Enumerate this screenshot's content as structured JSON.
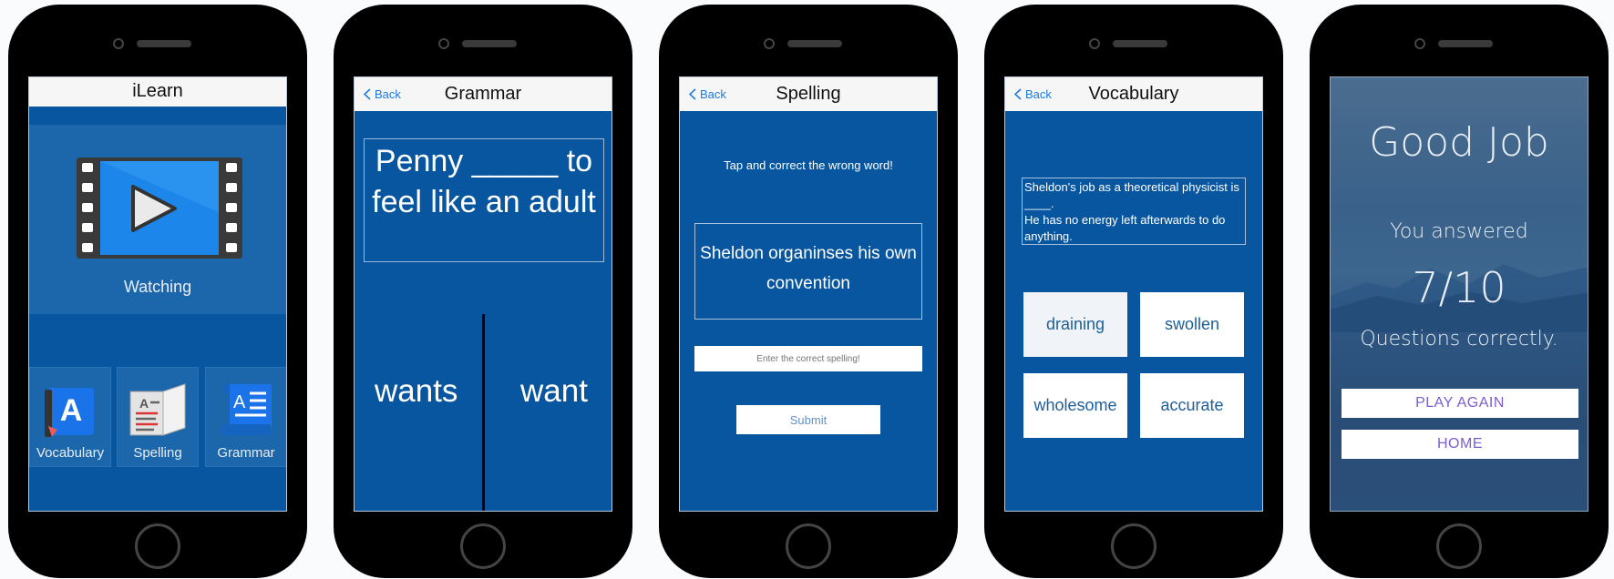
{
  "screen1": {
    "title": "iLearn",
    "watch_label": "Watching",
    "tiles": [
      {
        "label": "Vocabulary"
      },
      {
        "label": "Spelling"
      },
      {
        "label": "Grammar"
      }
    ]
  },
  "screen2": {
    "back": "Back",
    "title": "Grammar",
    "question": "Penny _____ to feel like an adult",
    "choices": [
      "wants",
      "want"
    ]
  },
  "screen3": {
    "back": "Back",
    "title": "Spelling",
    "instruction": "Tap and correct the wrong word!",
    "sentence": "Sheldon organinses his own convention",
    "input_placeholder": "Enter the correct spelling!",
    "submit_label": "Submit"
  },
  "screen4": {
    "back": "Back",
    "title": "Vocabulary",
    "question_line1": "Sheldon's job as a theoretical physicist is ____.",
    "question_line2": "He has no energy left afterwards to do anything.",
    "options": [
      "draining",
      "swollen",
      "wholesome",
      "accurate"
    ]
  },
  "screen5": {
    "headline": "Good Job",
    "you_answered": "You answered",
    "score": "7/10",
    "questions_correctly": "Questions correctly.",
    "play_again": "PLAY AGAIN",
    "home": "HOME"
  }
}
